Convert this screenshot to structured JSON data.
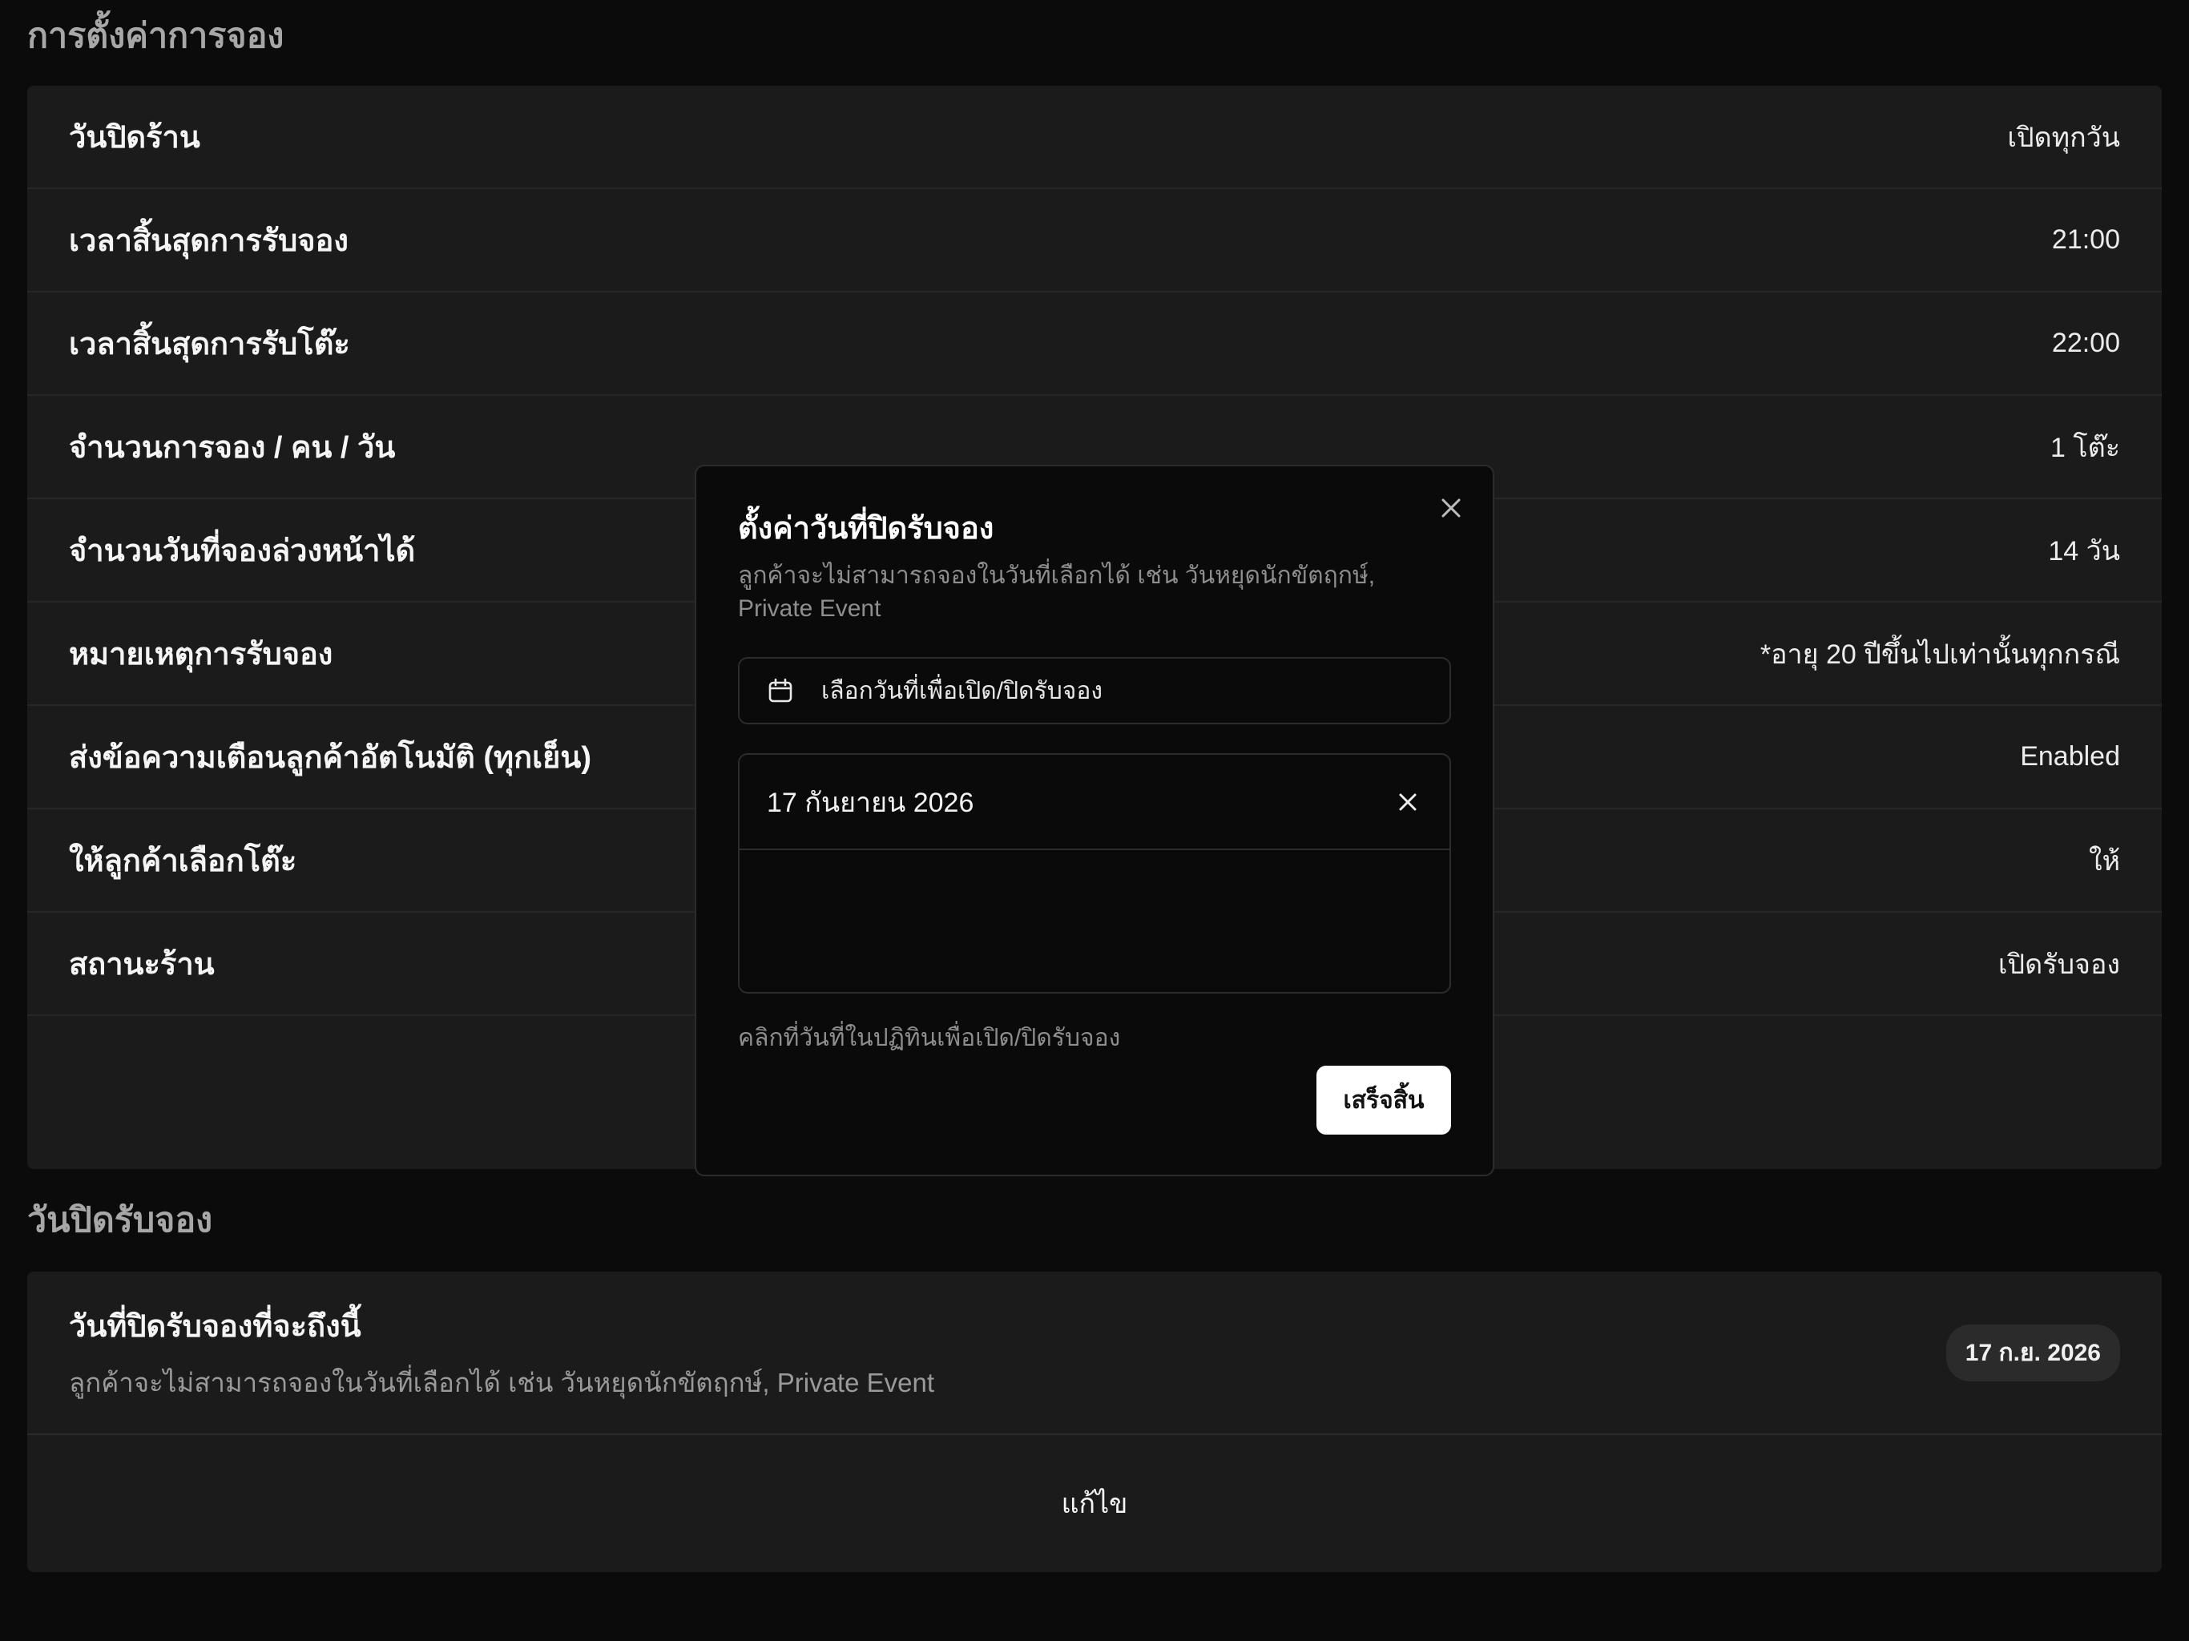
{
  "booking_settings": {
    "title": "การตั้งค่าการจอง",
    "rows": [
      {
        "label": "วันปิดร้าน",
        "value": "เปิดทุกวัน"
      },
      {
        "label": "เวลาสิ้นสุดการรับจอง",
        "value": "21:00"
      },
      {
        "label": "เวลาสิ้นสุดการรับโต๊ะ",
        "value": "22:00"
      },
      {
        "label": "จำนวนการจอง / คน / วัน",
        "value": "1 โต๊ะ"
      },
      {
        "label": "จำนวนวันที่จองล่วงหน้าได้",
        "value": "14 วัน"
      },
      {
        "label": "หมายเหตุการรับจอง",
        "value": "*อายุ 20 ปีขึ้นไปเท่านั้นทุกกรณี"
      },
      {
        "label": "ส่งข้อความเตือนลูกค้าอัตโนมัติ (ทุกเย็น)",
        "value": "Enabled"
      },
      {
        "label": "ให้ลูกค้าเลือกโต๊ะ",
        "value": "ให้"
      },
      {
        "label": "สถานะร้าน",
        "value": "เปิดรับจอง"
      }
    ]
  },
  "closure_section": {
    "title": "วันปิดรับจอง",
    "upcoming_title": "วันที่ปิดรับจองที่จะถึงนี้",
    "upcoming_desc": "ลูกค้าจะไม่สามารถจองในวันที่เลือกได้ เช่น วันหยุดนักขัตฤกษ์, Private Event",
    "date_badge": "17 ก.ย. 2026",
    "edit_label": "แก้ไข"
  },
  "modal": {
    "title": "ตั้งค่าวันที่ปิดรับจอง",
    "description": "ลูกค้าจะไม่สามารถจองในวันที่เลือกได้ เช่น วันหยุดนักขัตฤกษ์, Private Event",
    "date_picker_label": "เลือกวันที่เพื่อเปิด/ปิดรับจอง",
    "selected_dates": [
      "17 กันยายน 2026"
    ],
    "hint": "คลิกที่วันที่ในปฏิทินเพื่อเปิด/ปิดรับจอง",
    "done_label": "เสร็จสิ้น"
  },
  "icons": {
    "modal_close": "close-icon",
    "calendar": "calendar-icon",
    "remove_date": "close-icon"
  },
  "colors": {
    "background": "#0b0b0b",
    "card": "#1b1b1b",
    "modal": "#0a0a0a",
    "primary_button": "#ffffff"
  }
}
